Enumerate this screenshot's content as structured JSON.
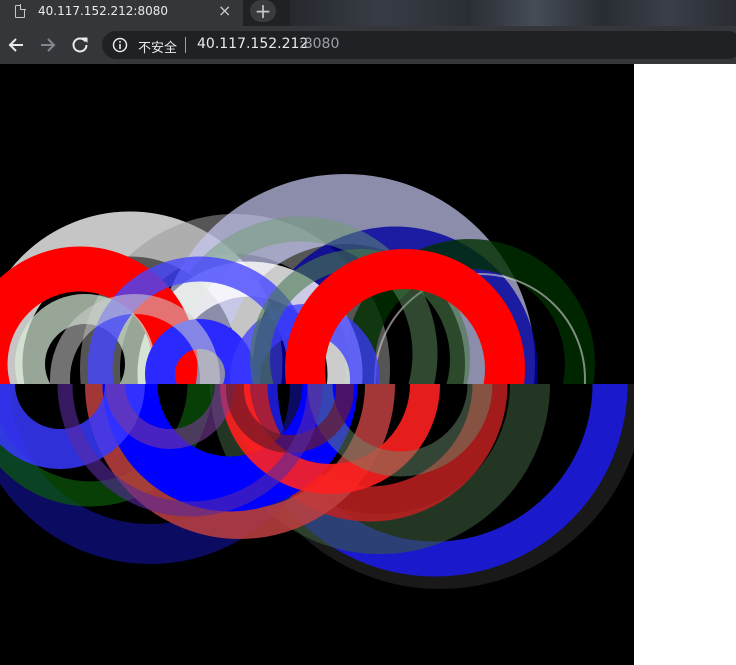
{
  "tab": {
    "title": "40.117.152.212:8080",
    "close_glyph": "×"
  },
  "new_tab_glyph": "+",
  "omnibox": {
    "security_label": "不安全",
    "host": "40.117.152.212",
    "port": ":8080"
  },
  "icons": {
    "tab": "file-icon",
    "back": "arrow-left-icon",
    "forward": "arrow-right-icon",
    "reload": "reload-icon",
    "security": "info-icon"
  },
  "colors": {
    "tabstrip": "#202124",
    "toolbar": "#35363a",
    "canvas_background": "#000000",
    "ring_palette": [
      "#ff0000",
      "#0000ff",
      "#ffffff",
      "#008000"
    ]
  }
}
